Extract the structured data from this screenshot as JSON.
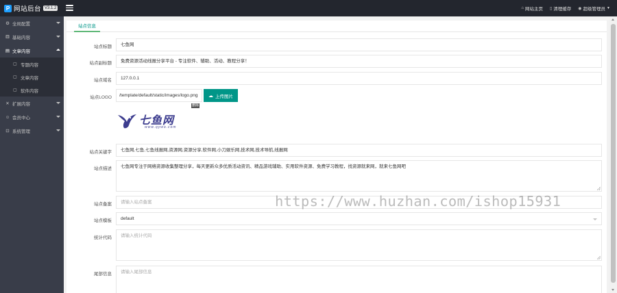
{
  "app": {
    "title": "网站后台",
    "version": "V3.1.2"
  },
  "topbar": {
    "links": [
      {
        "icon": "home-icon",
        "label": "网站主页"
      },
      {
        "icon": "trash-icon",
        "label": "清理缓存"
      },
      {
        "icon": "user-icon",
        "label": "超级管理员"
      }
    ]
  },
  "sidebar": {
    "items": [
      {
        "icon": "gear-icon",
        "label": "全局配置"
      },
      {
        "icon": "grid-icon",
        "label": "基础内容"
      },
      {
        "icon": "document-icon",
        "label": "文章内容"
      },
      {
        "icon": "expand-icon",
        "label": "扩展内容"
      },
      {
        "icon": "user-icon",
        "label": "会员中心"
      },
      {
        "icon": "lock-icon",
        "label": "系统管理"
      }
    ],
    "sub_items": [
      {
        "icon": "file-icon",
        "label": "专题内容"
      },
      {
        "icon": "file-icon",
        "label": "文章内容"
      },
      {
        "icon": "file-icon",
        "label": "软件内容"
      }
    ]
  },
  "tabs": [
    {
      "label": "站点信息"
    }
  ],
  "form": {
    "site_title": {
      "label": "站点标题",
      "value": "七鱼网"
    },
    "site_subtitle": {
      "label": "站点副标题",
      "value": "免费资源活动线报分享平台 - 专注软件、辅助、活动、教程分享！"
    },
    "site_domain": {
      "label": "站点域名",
      "value": "127.0.0.1"
    },
    "site_logo": {
      "label": "站点LOGO",
      "value": "/template/default/static/images/logo.png",
      "upload_label": "上传图片",
      "delete_badge": "删除"
    },
    "logo_image": {
      "name": "七鱼网",
      "url": "www.qywo.com"
    },
    "site_keywords": {
      "label": "站点关键字",
      "value": "七鱼网,七鱼,七鱼线报网,资源网,资源分享,软件网,小刀娱乐网,技术网,技术导航,线报网"
    },
    "site_description": {
      "label": "站点描述",
      "value": "七鱼网专注于网络资源收集整理分享，每天更新众多优质活动资讯、精品游戏辅助、实用软件资源、免费学习教程，找资源就来网，就来七鱼网吧"
    },
    "site_icp": {
      "label": "站点备案",
      "placeholder": "请输入站点备案"
    },
    "site_template": {
      "label": "站点模板",
      "value": "default"
    },
    "stats_code": {
      "label": "统计代码",
      "placeholder": "请输入统计代码"
    },
    "footer_info": {
      "label": "尾部信息",
      "placeholder": "请输入尾部信息"
    }
  },
  "watermark": "https://www.huzhan.com/ishop15931"
}
